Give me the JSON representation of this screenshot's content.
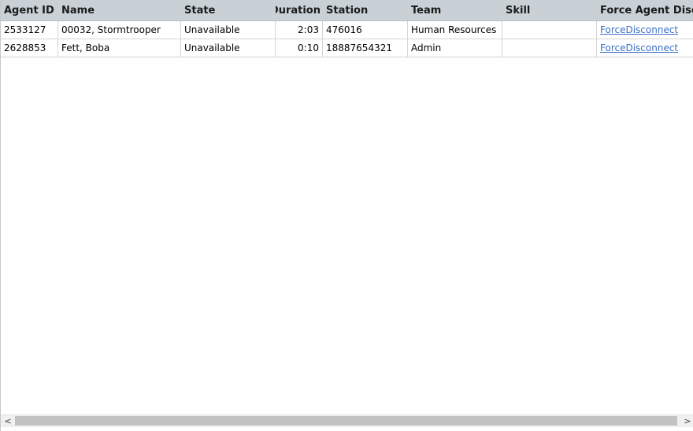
{
  "columns": {
    "agent_id": "Agent ID",
    "name": "Name",
    "state": "State",
    "duration": "Duration",
    "station": "Station",
    "team": "Team",
    "skill": "Skill",
    "force": "Force Agent Disconn"
  },
  "rows": [
    {
      "agent_id": "2533127",
      "name": "00032, Stormtrooper",
      "state": "Unavailable",
      "duration": "2:03",
      "station": "476016",
      "team": "Human Resources",
      "skill": "",
      "force": "ForceDisconnect"
    },
    {
      "agent_id": "2628853",
      "name": "Fett, Boba",
      "state": "Unavailable",
      "duration": "0:10",
      "station": "18887654321",
      "team": "Admin",
      "skill": "",
      "force": "ForceDisconnect"
    }
  ],
  "scrollbar": {
    "left_arrow": "<",
    "right_arrow": ">"
  },
  "colors": {
    "header_bg": "#c9d1d6",
    "link": "#3b6fc4",
    "scroll_thumb": "#c2c2c2"
  }
}
